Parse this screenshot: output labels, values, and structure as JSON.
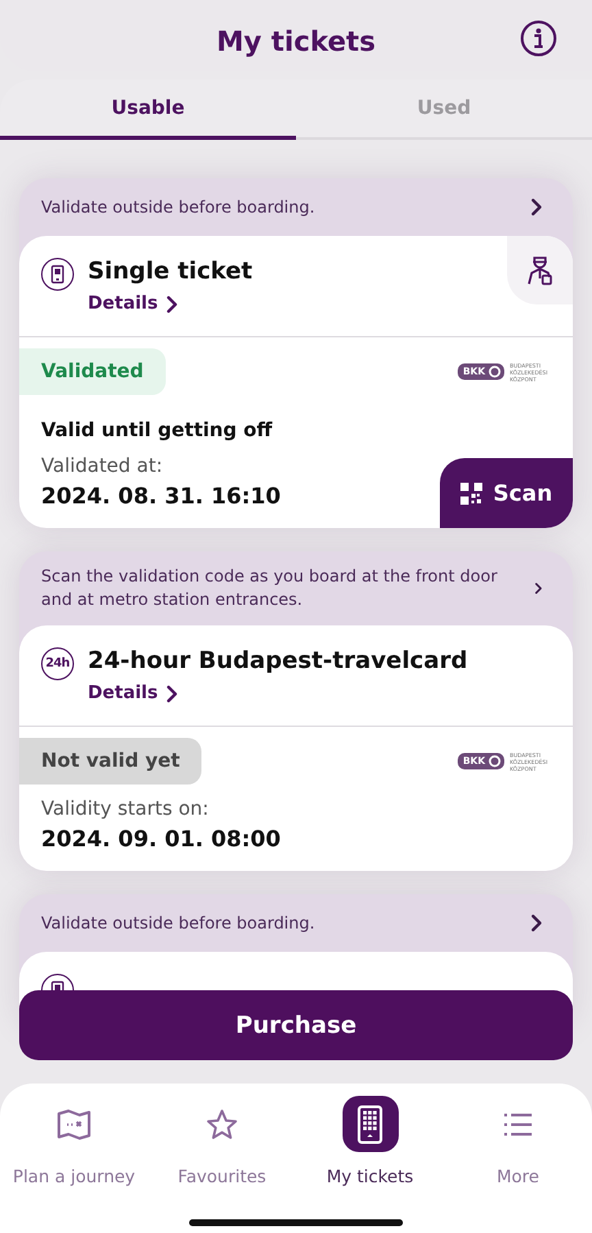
{
  "header": {
    "title": "My tickets"
  },
  "tabs": [
    {
      "label": "Usable",
      "selected": true
    },
    {
      "label": "Used",
      "selected": false
    }
  ],
  "tickets": [
    {
      "notice": "Validate outside before boarding.",
      "kind": "single",
      "title": "Single ticket",
      "details": "Details",
      "conductor": true,
      "status": {
        "kind": "validated",
        "label": "Validated"
      },
      "validity": "Valid until getting off",
      "time_label": "Validated at:",
      "time": "2024. 08. 31. 16:10",
      "logo": {
        "mark": "BKK",
        "caption": "BUDAPESTI KÖZLEKEDÉSI KÖZPONT"
      },
      "scan": "Scan"
    },
    {
      "notice": "Scan the validation code as you board at the front door and at metro station entrances.",
      "kind": "day",
      "icon_text": "24h",
      "title": "24-hour Budapest-travelcard",
      "details": "Details",
      "conductor": false,
      "status": {
        "kind": "pending",
        "label": "Not valid yet"
      },
      "time_label": "Validity starts on:",
      "time": "2024. 09. 01. 08:00",
      "logo": {
        "mark": "BKK",
        "caption": "BUDAPESTI KÖZLEKEDÉSI KÖZPONT"
      }
    },
    {
      "notice": "Validate outside before boarding.",
      "kind": "single"
    }
  ],
  "purchase": "Purchase",
  "nav": [
    {
      "kind": "map",
      "label": "Plan a journey",
      "selected": false
    },
    {
      "kind": "star",
      "label": "Favourites",
      "selected": false
    },
    {
      "kind": "ticket",
      "label": "My tickets",
      "selected": true
    },
    {
      "kind": "list",
      "label": "More",
      "selected": false
    }
  ]
}
